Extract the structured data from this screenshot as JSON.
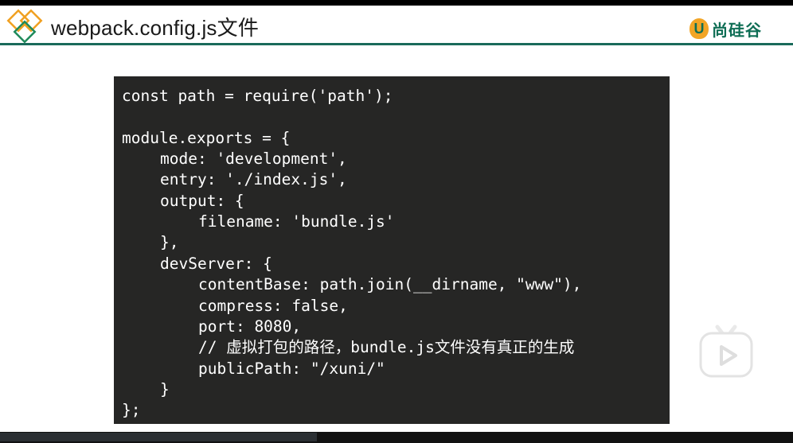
{
  "slide": {
    "title": "webpack.config.js文件",
    "brand": {
      "mark_letter": "U",
      "name": "尚硅谷"
    }
  },
  "code": {
    "lines": [
      {
        "indent": 0,
        "text": "const path = require('path');"
      },
      {
        "indent": 0,
        "text": ""
      },
      {
        "indent": 0,
        "text": "module.exports = {"
      },
      {
        "indent": 1,
        "text": "mode: 'development',"
      },
      {
        "indent": 1,
        "text": "entry: './index.js',"
      },
      {
        "indent": 1,
        "text": "output: {"
      },
      {
        "indent": 2,
        "text": "filename: 'bundle.js'"
      },
      {
        "indent": 1,
        "text": "},"
      },
      {
        "indent": 1,
        "text": "devServer: {"
      },
      {
        "indent": 2,
        "text": "contentBase: path.join(__dirname, \"www\"),"
      },
      {
        "indent": 2,
        "text": "compress: false,"
      },
      {
        "indent": 2,
        "text": "port: 8080,"
      },
      {
        "indent": 2,
        "text": "// 虚拟打包的路径，bundle.js文件没有真正的生成"
      },
      {
        "indent": 2,
        "text": "publicPath: \"/xuni/\""
      },
      {
        "indent": 1,
        "text": "}"
      },
      {
        "indent": 0,
        "text": "};"
      }
    ]
  },
  "player": {
    "play_icon": "play-icon",
    "progress_fraction": 0.4
  },
  "colors": {
    "header_rule": "#1a6a5a",
    "code_bg": "#262625",
    "brand_green": "#0f6e55",
    "brand_orange": "#f2a526",
    "diamond_orange": "#f0a020",
    "diamond_green": "#1f8a5a"
  }
}
